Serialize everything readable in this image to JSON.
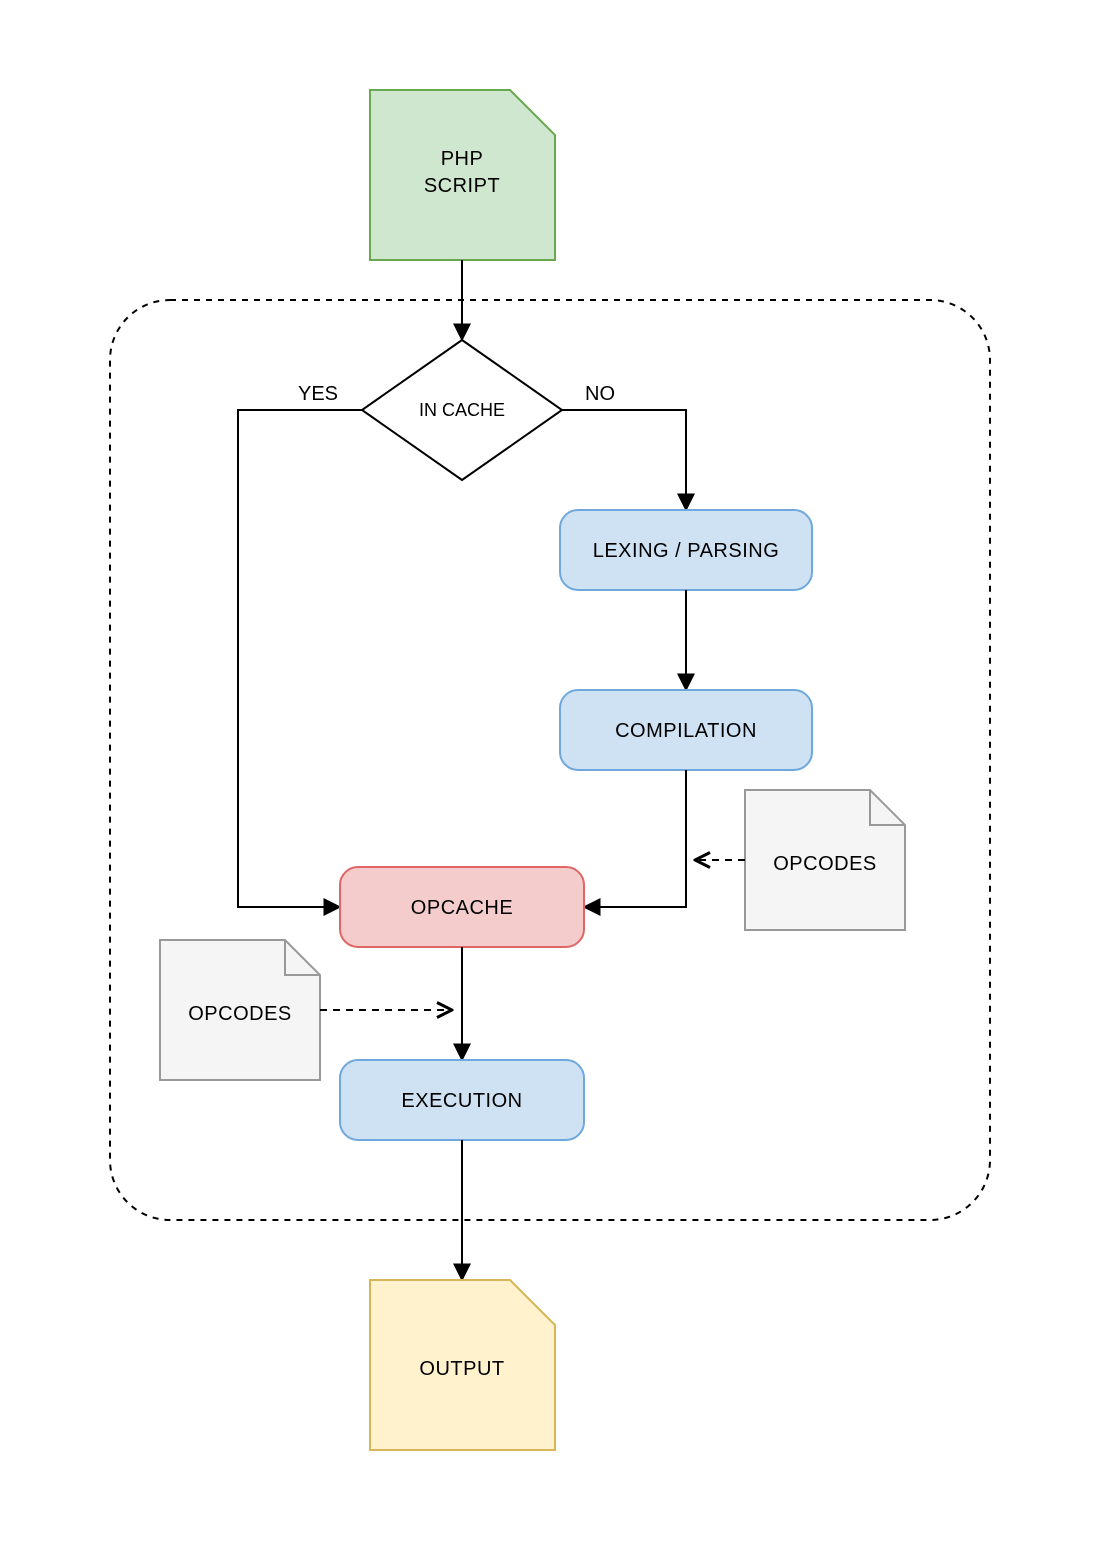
{
  "nodes": {
    "php_script": {
      "line1": "PHP",
      "line2": "SCRIPT"
    },
    "in_cache": {
      "label": "IN CACHE"
    },
    "lexing": {
      "label": "LEXING / PARSING"
    },
    "compilation": {
      "label": "COMPILATION"
    },
    "opcache": {
      "label": "OPCACHE"
    },
    "execution": {
      "label": "EXECUTION"
    },
    "output": {
      "label": "OUTPUT"
    },
    "opcodes_right": {
      "label": "OPCODES"
    },
    "opcodes_left": {
      "label": "OPCODES"
    }
  },
  "edges": {
    "yes": "YES",
    "no": "NO"
  },
  "colors": {
    "green_fill": "#d0e7cf",
    "green_stroke": "#6aa84f",
    "blue_fill": "#cfe2f3",
    "blue_stroke": "#6fa8dc",
    "red_fill": "#f4cccc",
    "red_stroke": "#e06666",
    "yellow_fill": "#fff2cc",
    "yellow_stroke": "#d6b656",
    "grey_fill": "#f5f5f5",
    "grey_stroke": "#999999",
    "black": "#000000"
  }
}
